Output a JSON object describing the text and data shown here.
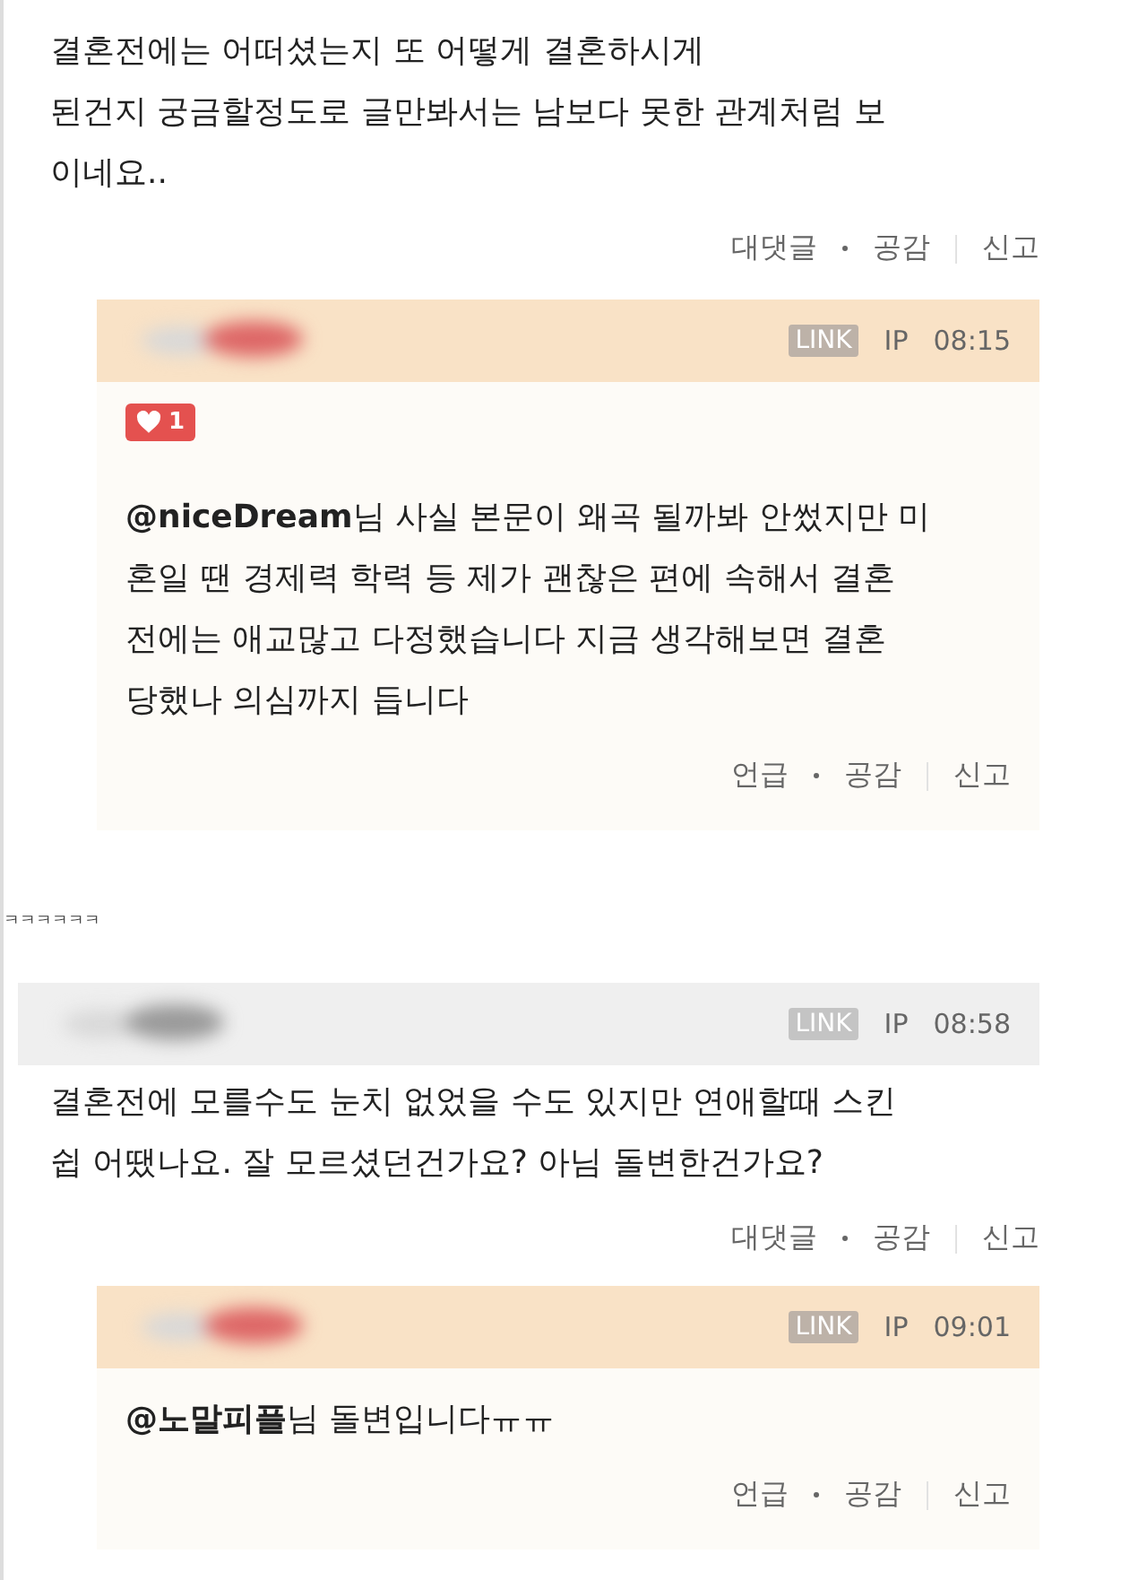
{
  "items": [
    {
      "kind": "comment",
      "text": "결혼전에는 어떠셨는지 또 어떻게 결혼하시게\n된건지 궁금할정도로 글만봐서는 남보다 못한 관계처럼 보\n이네요..",
      "actions": [
        "대댓글",
        "공감",
        "신고"
      ]
    },
    {
      "kind": "reply",
      "tag": "LINK",
      "ip": "IP",
      "time": "08:15",
      "likes": "1",
      "text": "**@niceDream**님 사실 본문이 왜곡 될까봐 안썼지만 미\n혼일 땐 경제력 학력 등 제가 괜찮은 편에 속해서 결혼\n전에는 애교많고 다정했습니다 지금 생각해보면 결혼\n당했나 의심까지 듭니다",
      "actions": [
        "언급",
        "공감",
        "신고"
      ]
    },
    {
      "kind": "note",
      "text": "ㅋㅋㅋㅋㅋㅋ"
    },
    {
      "kind": "comment",
      "tag": "LINK",
      "ip": "IP",
      "time": "08:58",
      "text": "결혼전에 모를수도 눈치 없었을 수도 있지만 연애할때 스킨\n쉽 어땠나요. 잘 모르셨던건가요? 아님 돌변한건가요?",
      "actions": [
        "대댓글",
        "공감",
        "신고"
      ]
    },
    {
      "kind": "reply",
      "tag": "LINK",
      "ip": "IP",
      "time": "09:01",
      "text": "**@노말피플**님 돌변입니다ㅠㅠ",
      "actions": [
        "언급",
        "공감",
        "신고"
      ]
    }
  ]
}
